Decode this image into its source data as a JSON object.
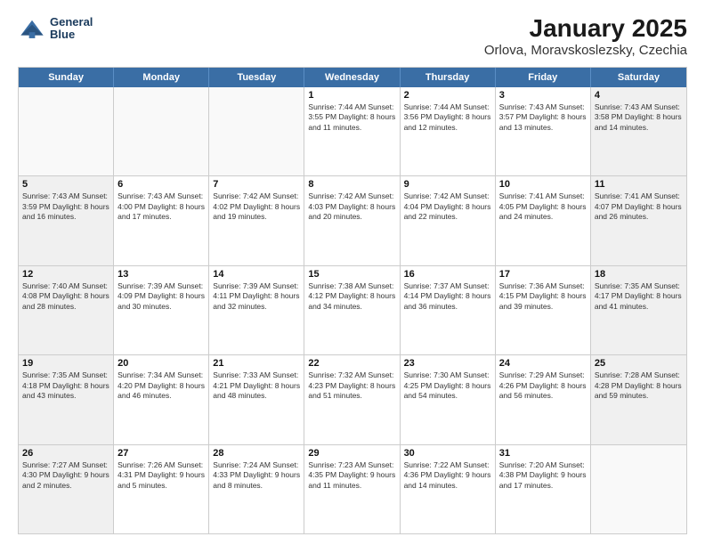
{
  "logo": {
    "line1": "General",
    "line2": "Blue"
  },
  "title": "January 2025",
  "subtitle": "Orlova, Moravskoslezsky, Czechia",
  "weekdays": [
    "Sunday",
    "Monday",
    "Tuesday",
    "Wednesday",
    "Thursday",
    "Friday",
    "Saturday"
  ],
  "rows": [
    [
      {
        "day": "",
        "text": "",
        "empty": true
      },
      {
        "day": "",
        "text": "",
        "empty": true
      },
      {
        "day": "",
        "text": "",
        "empty": true
      },
      {
        "day": "1",
        "text": "Sunrise: 7:44 AM\nSunset: 3:55 PM\nDaylight: 8 hours\nand 11 minutes.",
        "shaded": false
      },
      {
        "day": "2",
        "text": "Sunrise: 7:44 AM\nSunset: 3:56 PM\nDaylight: 8 hours\nand 12 minutes.",
        "shaded": false
      },
      {
        "day": "3",
        "text": "Sunrise: 7:43 AM\nSunset: 3:57 PM\nDaylight: 8 hours\nand 13 minutes.",
        "shaded": false
      },
      {
        "day": "4",
        "text": "Sunrise: 7:43 AM\nSunset: 3:58 PM\nDaylight: 8 hours\nand 14 minutes.",
        "shaded": true
      }
    ],
    [
      {
        "day": "5",
        "text": "Sunrise: 7:43 AM\nSunset: 3:59 PM\nDaylight: 8 hours\nand 16 minutes.",
        "shaded": true
      },
      {
        "day": "6",
        "text": "Sunrise: 7:43 AM\nSunset: 4:00 PM\nDaylight: 8 hours\nand 17 minutes.",
        "shaded": false
      },
      {
        "day": "7",
        "text": "Sunrise: 7:42 AM\nSunset: 4:02 PM\nDaylight: 8 hours\nand 19 minutes.",
        "shaded": false
      },
      {
        "day": "8",
        "text": "Sunrise: 7:42 AM\nSunset: 4:03 PM\nDaylight: 8 hours\nand 20 minutes.",
        "shaded": false
      },
      {
        "day": "9",
        "text": "Sunrise: 7:42 AM\nSunset: 4:04 PM\nDaylight: 8 hours\nand 22 minutes.",
        "shaded": false
      },
      {
        "day": "10",
        "text": "Sunrise: 7:41 AM\nSunset: 4:05 PM\nDaylight: 8 hours\nand 24 minutes.",
        "shaded": false
      },
      {
        "day": "11",
        "text": "Sunrise: 7:41 AM\nSunset: 4:07 PM\nDaylight: 8 hours\nand 26 minutes.",
        "shaded": true
      }
    ],
    [
      {
        "day": "12",
        "text": "Sunrise: 7:40 AM\nSunset: 4:08 PM\nDaylight: 8 hours\nand 28 minutes.",
        "shaded": true
      },
      {
        "day": "13",
        "text": "Sunrise: 7:39 AM\nSunset: 4:09 PM\nDaylight: 8 hours\nand 30 minutes.",
        "shaded": false
      },
      {
        "day": "14",
        "text": "Sunrise: 7:39 AM\nSunset: 4:11 PM\nDaylight: 8 hours\nand 32 minutes.",
        "shaded": false
      },
      {
        "day": "15",
        "text": "Sunrise: 7:38 AM\nSunset: 4:12 PM\nDaylight: 8 hours\nand 34 minutes.",
        "shaded": false
      },
      {
        "day": "16",
        "text": "Sunrise: 7:37 AM\nSunset: 4:14 PM\nDaylight: 8 hours\nand 36 minutes.",
        "shaded": false
      },
      {
        "day": "17",
        "text": "Sunrise: 7:36 AM\nSunset: 4:15 PM\nDaylight: 8 hours\nand 39 minutes.",
        "shaded": false
      },
      {
        "day": "18",
        "text": "Sunrise: 7:35 AM\nSunset: 4:17 PM\nDaylight: 8 hours\nand 41 minutes.",
        "shaded": true
      }
    ],
    [
      {
        "day": "19",
        "text": "Sunrise: 7:35 AM\nSunset: 4:18 PM\nDaylight: 8 hours\nand 43 minutes.",
        "shaded": true
      },
      {
        "day": "20",
        "text": "Sunrise: 7:34 AM\nSunset: 4:20 PM\nDaylight: 8 hours\nand 46 minutes.",
        "shaded": false
      },
      {
        "day": "21",
        "text": "Sunrise: 7:33 AM\nSunset: 4:21 PM\nDaylight: 8 hours\nand 48 minutes.",
        "shaded": false
      },
      {
        "day": "22",
        "text": "Sunrise: 7:32 AM\nSunset: 4:23 PM\nDaylight: 8 hours\nand 51 minutes.",
        "shaded": false
      },
      {
        "day": "23",
        "text": "Sunrise: 7:30 AM\nSunset: 4:25 PM\nDaylight: 8 hours\nand 54 minutes.",
        "shaded": false
      },
      {
        "day": "24",
        "text": "Sunrise: 7:29 AM\nSunset: 4:26 PM\nDaylight: 8 hours\nand 56 minutes.",
        "shaded": false
      },
      {
        "day": "25",
        "text": "Sunrise: 7:28 AM\nSunset: 4:28 PM\nDaylight: 8 hours\nand 59 minutes.",
        "shaded": true
      }
    ],
    [
      {
        "day": "26",
        "text": "Sunrise: 7:27 AM\nSunset: 4:30 PM\nDaylight: 9 hours\nand 2 minutes.",
        "shaded": true
      },
      {
        "day": "27",
        "text": "Sunrise: 7:26 AM\nSunset: 4:31 PM\nDaylight: 9 hours\nand 5 minutes.",
        "shaded": false
      },
      {
        "day": "28",
        "text": "Sunrise: 7:24 AM\nSunset: 4:33 PM\nDaylight: 9 hours\nand 8 minutes.",
        "shaded": false
      },
      {
        "day": "29",
        "text": "Sunrise: 7:23 AM\nSunset: 4:35 PM\nDaylight: 9 hours\nand 11 minutes.",
        "shaded": false
      },
      {
        "day": "30",
        "text": "Sunrise: 7:22 AM\nSunset: 4:36 PM\nDaylight: 9 hours\nand 14 minutes.",
        "shaded": false
      },
      {
        "day": "31",
        "text": "Sunrise: 7:20 AM\nSunset: 4:38 PM\nDaylight: 9 hours\nand 17 minutes.",
        "shaded": false
      },
      {
        "day": "",
        "text": "",
        "empty": true,
        "shaded": true
      }
    ]
  ]
}
